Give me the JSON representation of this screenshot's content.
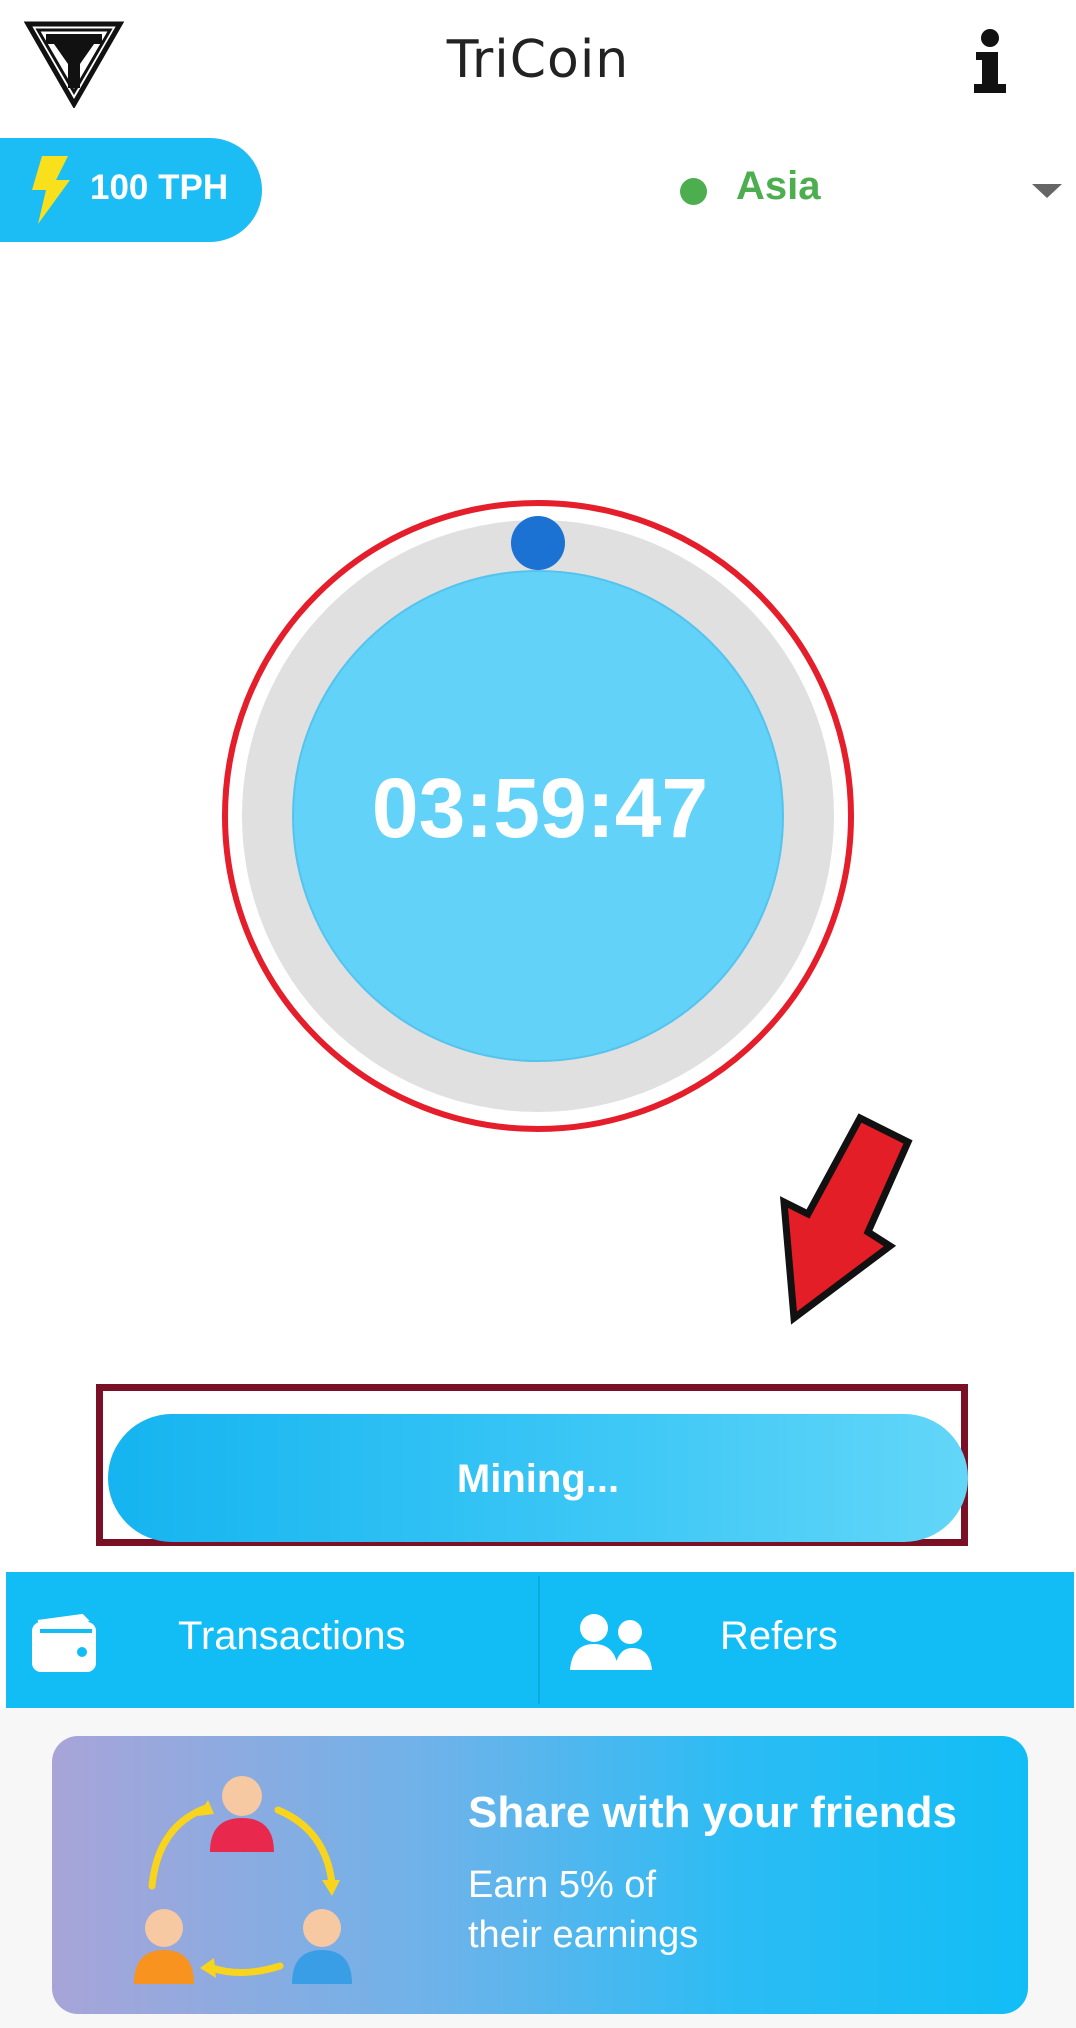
{
  "header": {
    "title": "TriCoin",
    "logo_icon": "tricoin-logo-icon",
    "info_icon": "info-icon"
  },
  "rate": {
    "label": "100 TPH",
    "icon": "lightning-bolt-icon"
  },
  "region": {
    "label": "Asia",
    "status_color": "#4cae4f",
    "dropdown_icon": "caret-down-icon"
  },
  "timer": {
    "value": "03:59:47"
  },
  "mining_button": {
    "label": "Mining..."
  },
  "nav": {
    "items": [
      {
        "label": "Transactions",
        "icon": "wallet-icon"
      },
      {
        "label": "Refers",
        "icon": "people-icon"
      }
    ]
  },
  "share_banner": {
    "title": "Share with your friends",
    "subtitle_line1": "Earn 5% of",
    "subtitle_line2": "their earnings"
  },
  "colors": {
    "accent": "#12bdf5",
    "highlight_ring": "#e41e2b",
    "frame": "#7a1026",
    "arrow": "#e41e26"
  }
}
